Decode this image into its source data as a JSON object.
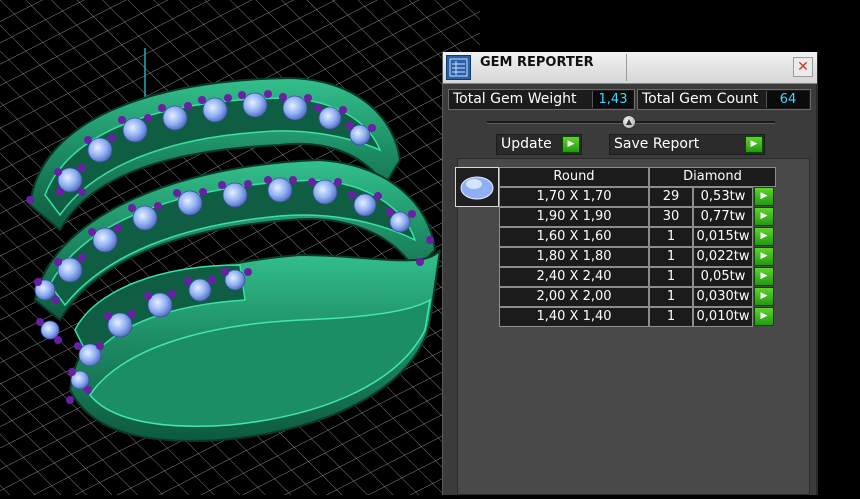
{
  "panel": {
    "title": "GEM REPORTER",
    "close_glyph": "✕",
    "icon": "gem-reporter-icon",
    "total_gem_weight_label": "Total Gem Weight",
    "total_gem_weight_value": "1,43",
    "total_gem_count_label": "Total Gem Count",
    "total_gem_count_value": "64",
    "update_label": "Update",
    "save_report_label": "Save Report",
    "table": {
      "shape_header": "Round",
      "stone_header": "Diamond",
      "rows": [
        {
          "size": "1,70 X 1,70",
          "count": "29",
          "weight": "0,53tw"
        },
        {
          "size": "1,90 X 1,90",
          "count": "30",
          "weight": "0,77tw"
        },
        {
          "size": "1,60 X 1,60",
          "count": "1",
          "weight": "0,015tw"
        },
        {
          "size": "1,80 X 1,80",
          "count": "1",
          "weight": "0,022tw"
        },
        {
          "size": "2,40 X 2,40",
          "count": "1",
          "weight": "0,05tw"
        },
        {
          "size": "2,00 X 2,00",
          "count": "1",
          "weight": "0,030tw"
        },
        {
          "size": "1,40 X 1,40",
          "count": "1",
          "weight": "0,010tw"
        }
      ]
    }
  },
  "colors": {
    "accent_value": "#3fd7ff",
    "arrow_green": "#3fbf1f",
    "ring_green": "#1f9a6e",
    "gem_blue": "#9ab8f5",
    "prong_purple": "#6a1fa6"
  }
}
